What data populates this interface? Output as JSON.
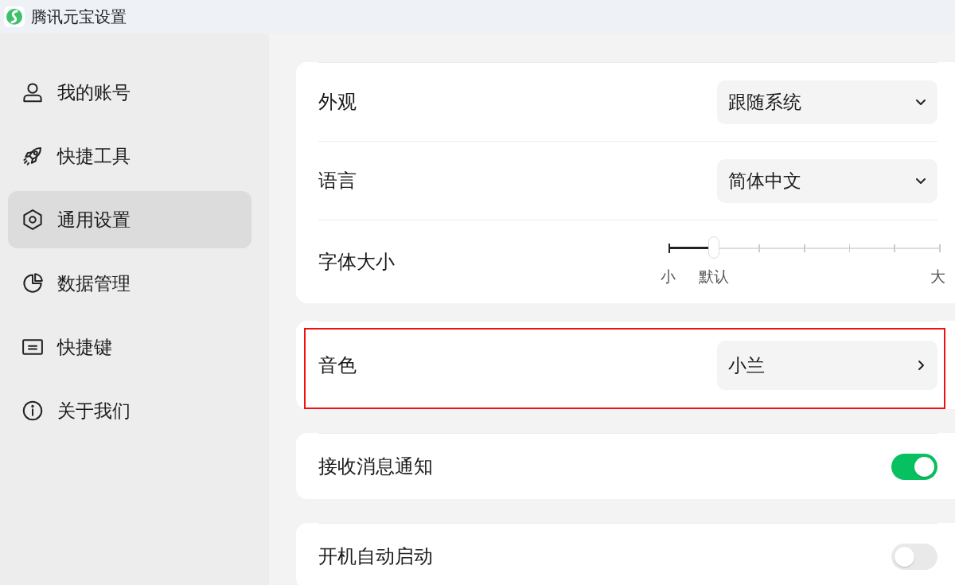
{
  "window": {
    "title": "腾讯元宝设置"
  },
  "sidebar": {
    "items": [
      {
        "label": "我的账号",
        "selected": false
      },
      {
        "label": "快捷工具",
        "selected": false
      },
      {
        "label": "通用设置",
        "selected": true
      },
      {
        "label": "数据管理",
        "selected": false
      },
      {
        "label": "快捷键",
        "selected": false
      },
      {
        "label": "关于我们",
        "selected": false
      }
    ]
  },
  "sections": [
    {
      "highlighted": false,
      "rows": [
        {
          "kind": "dropdown",
          "label": "外观",
          "value": "跟随系统"
        },
        {
          "kind": "dropdown",
          "label": "语言",
          "value": "简体中文"
        },
        {
          "kind": "slider",
          "label": "字体大小",
          "level": 0.1667,
          "marks": [
            "小",
            "默认",
            "大"
          ]
        }
      ]
    },
    {
      "highlighted": true,
      "rows": [
        {
          "kind": "link",
          "label": "音色",
          "value": "小兰"
        }
      ]
    },
    {
      "highlighted": false,
      "rows": [
        {
          "kind": "toggle",
          "label": "接收消息通知",
          "on": true
        }
      ]
    },
    {
      "highlighted": false,
      "rows": [
        {
          "kind": "toggle",
          "label": "开机自动启动",
          "on": false
        }
      ]
    }
  ]
}
